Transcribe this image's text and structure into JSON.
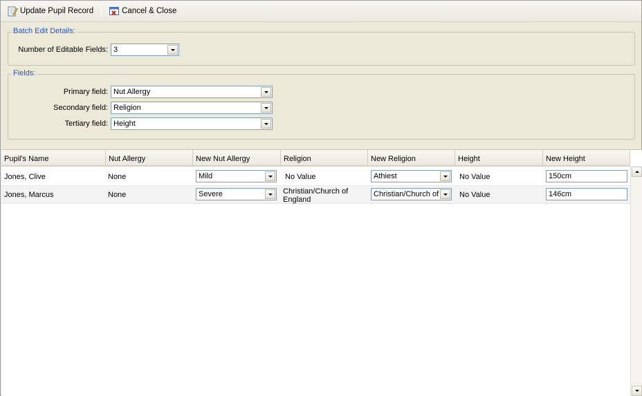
{
  "toolbar": {
    "update_label": "Update Pupil Record",
    "cancel_label": "Cancel & Close"
  },
  "batch": {
    "legend": "Batch Edit Details:",
    "editable_fields_label": "Number of Editable Fields:",
    "editable_fields_value": "3"
  },
  "fields": {
    "legend": "Fields:",
    "primary_label": "Primary field:",
    "primary_value": "Nut Allergy",
    "secondary_label": "Secondary field:",
    "secondary_value": "Religion",
    "tertiary_label": "Tertiary field:",
    "tertiary_value": "Height"
  },
  "grid": {
    "columns": [
      "Pupil's Name",
      "Nut Allergy",
      "New Nut Allergy",
      "Religion",
      "New Religion",
      "Height",
      "New Height"
    ],
    "rows": [
      {
        "name": "Jones, Clive",
        "nut_allergy": "None",
        "new_nut_allergy": "Mild",
        "religion": "No Value",
        "new_religion": "Athiest",
        "height": "No Value",
        "new_height": "150cm"
      },
      {
        "name": "Jones, Marcus",
        "nut_allergy": "None",
        "new_nut_allergy": "Severe",
        "religion": "Christian/Church of England",
        "new_religion": "Christian/Church of",
        "height": "No Value",
        "new_height": "146cm"
      }
    ]
  }
}
